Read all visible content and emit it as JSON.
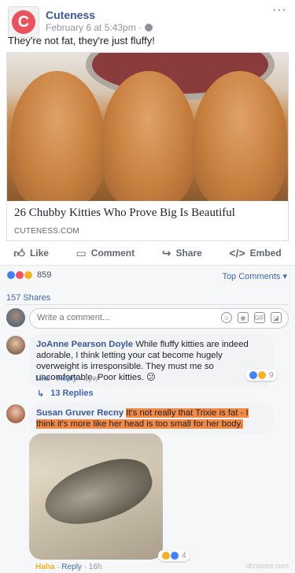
{
  "post": {
    "page_name": "Cuteness",
    "page_initial": "C",
    "timestamp": "February 6 at 5:43pm ·",
    "text": "They're not fat, they're just fluffy!",
    "more_label": "···"
  },
  "link_preview": {
    "title": "26 Chubby Kitties Who Prove Big Is Beautiful",
    "domain": "CUTENESS.COM"
  },
  "actions": {
    "like": "Like",
    "comment": "Comment",
    "share": "Share",
    "embed": "Embed"
  },
  "reactions": {
    "count": "859",
    "top_comments_label": "Top Comments ▾",
    "shares_label": "157 Shares"
  },
  "comment_input": {
    "placeholder": "Write a comment..."
  },
  "comments": [
    {
      "author": "JoAnne Pearson Doyle",
      "text": "While fluffy kitties are indeed adorable, I think letting your cat become hugely overweight is irresponsible. They must me so uncomfortable. Poor kitties. 😕",
      "like": "Like",
      "reply": "Reply",
      "age": "1yw",
      "reaction_count": "9",
      "replies_label": "13 Replies"
    },
    {
      "author": "Susan Gruver Recny",
      "text": "It's not really that Trixie is fat - I think it's more like her head is too small for her body.",
      "like": "Haha",
      "reply": "Reply",
      "age": "16h",
      "reaction_count": "4"
    }
  ],
  "watermark": "dbnstore.com",
  "colors": {
    "link_blue": "#385898",
    "accent": "#4267b2",
    "brand": "#e8535e",
    "highlight": "#f28a45",
    "haha_label": "#f7b125"
  }
}
